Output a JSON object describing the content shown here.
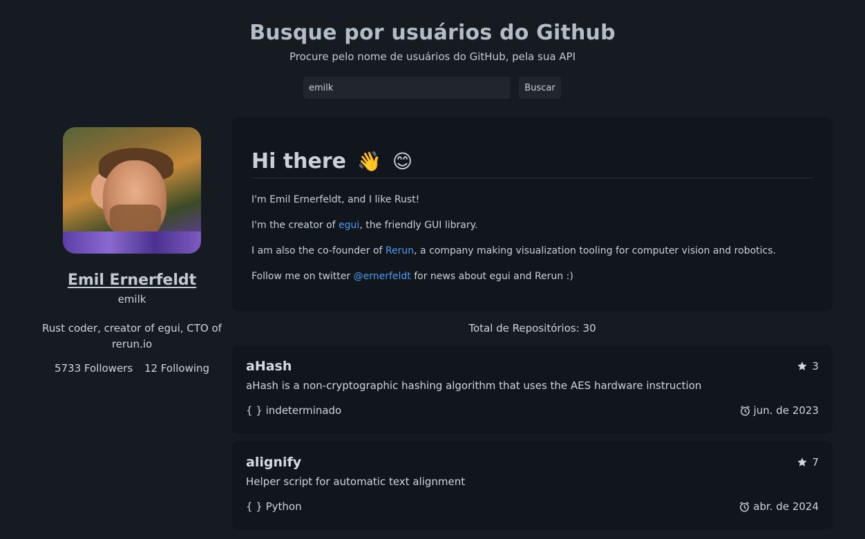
{
  "header": {
    "title": "Busque por usuários do Github",
    "subtitle": "Procure pelo nome de usuários do GitHub, pela sua API"
  },
  "search": {
    "value": "emilk",
    "button_label": "Buscar"
  },
  "profile": {
    "name": "Emil Ernerfeldt",
    "login": "emilk",
    "bio": "Rust coder, creator of egui, CTO of rerun.io",
    "followers": "5733 Followers",
    "following": "12 Following"
  },
  "readme": {
    "heading": "Hi there",
    "emoji_wave": "👋",
    "emoji_smile": "😊",
    "p1": "I'm Emil Ernerfeldt, and I like Rust!",
    "p2_before": "I'm the creator of ",
    "p2_link": "egui",
    "p2_after": ", the friendly GUI library.",
    "p3_before": "I am also the co-founder of ",
    "p3_link": "Rerun",
    "p3_after": ", a company making visualization tooling for computer vision and robotics.",
    "p4_before": "Follow me on twitter ",
    "p4_link": "@ernerfeldt",
    "p4_after": " for news about egui and Rerun :)"
  },
  "repos": {
    "total_label": "Total de Repositórios: 30",
    "items": [
      {
        "name": "aHash",
        "stars": "3",
        "description": "aHash is a non-cryptographic hashing algorithm that uses the AES hardware instruction",
        "language": "{ } indeterminado",
        "date": "jun. de 2023"
      },
      {
        "name": "alignify",
        "stars": "7",
        "description": "Helper script for automatic text alignment",
        "language": "{ } Python",
        "date": "abr. de 2024"
      }
    ]
  },
  "colors": {
    "background": "#161b22",
    "card": "#11161d",
    "link": "#4a9cf0"
  },
  "icons": [
    "star-icon",
    "alarm-clock-icon"
  ]
}
